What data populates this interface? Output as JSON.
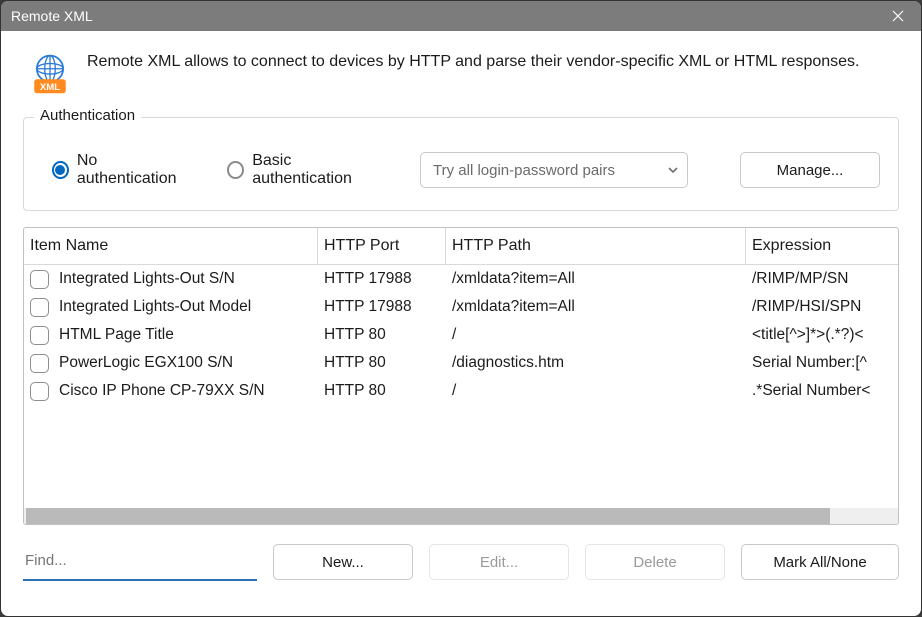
{
  "window": {
    "title": "Remote XML"
  },
  "intro": "Remote XML allows to connect to devices by HTTP and parse their vendor-specific XML or HTML responses.",
  "auth": {
    "legend": "Authentication",
    "no_auth_label": "No authentication",
    "basic_auth_label": "Basic authentication",
    "combo_selected": "Try all login-password pairs",
    "manage_label": "Manage..."
  },
  "table": {
    "headers": {
      "name": "Item Name",
      "port": "HTTP Port",
      "path": "HTTP Path",
      "expr": "Expression"
    },
    "rows": [
      {
        "name": "Integrated Lights-Out S/N",
        "port": "HTTP 17988",
        "path": "/xmldata?item=All",
        "expr": "/RIMP/MP/SN"
      },
      {
        "name": "Integrated Lights-Out Model",
        "port": "HTTP 17988",
        "path": "/xmldata?item=All",
        "expr": "/RIMP/HSI/SPN"
      },
      {
        "name": "HTML Page Title",
        "port": "HTTP 80",
        "path": "/",
        "expr": "<title[^>]*>(.*?)<"
      },
      {
        "name": "PowerLogic EGX100 S/N",
        "port": "HTTP 80",
        "path": "/diagnostics.htm",
        "expr": "Serial Number:[^"
      },
      {
        "name": "Cisco IP Phone CP-79XX S/N",
        "port": "HTTP 80",
        "path": "/",
        "expr": ".*Serial Number<"
      }
    ]
  },
  "bottom": {
    "find_placeholder": "Find...",
    "new_label": "New...",
    "edit_label": "Edit...",
    "delete_label": "Delete",
    "mark_label": "Mark All/None"
  }
}
